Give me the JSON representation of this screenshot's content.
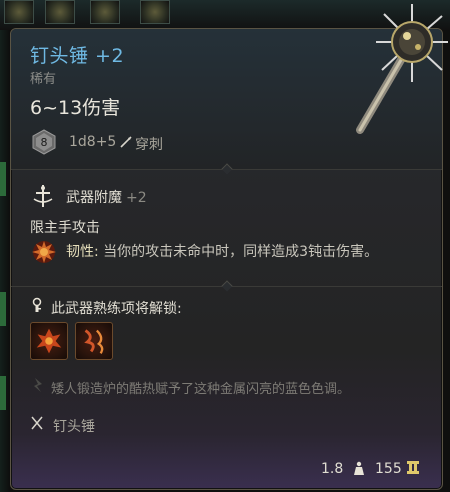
{
  "item": {
    "name": "钉头锤 +2",
    "rarity": "稀有",
    "damage": "6~13伤害",
    "die_value": "8",
    "dice": "1d8+5",
    "damage_type": "穿刺"
  },
  "enchant": {
    "title": "武器附魔",
    "bonus": "+2",
    "restriction": "限主手攻击",
    "toughness_label": "韧性:",
    "toughness_text": " 当你的攻击未命中时，同样造成3钝击伤害。"
  },
  "proficiency": {
    "label": "此武器熟练项将解锁:",
    "skills": [
      "skill-1",
      "skill-2"
    ]
  },
  "lore": "矮人锻造炉的酷热赋予了这种金属闪亮的蓝色色调。",
  "weapon_class": "钉头锤",
  "footer": {
    "weight": "1.8",
    "price": "155"
  },
  "colors": {
    "title": "#6fb9e3",
    "text": "#e0ddd2",
    "muted": "#8b8c88",
    "border": "#5a5444"
  },
  "icons": {
    "die": "d8-die-icon",
    "pierce": "piercing-icon",
    "enchant": "weapon-enchant-icon",
    "toughness": "toughness-icon",
    "unlock": "unlock-icon",
    "lore": "lore-icon",
    "class": "crossed-weapons-icon",
    "weight": "weight-icon",
    "coin": "gold-coin-icon"
  }
}
